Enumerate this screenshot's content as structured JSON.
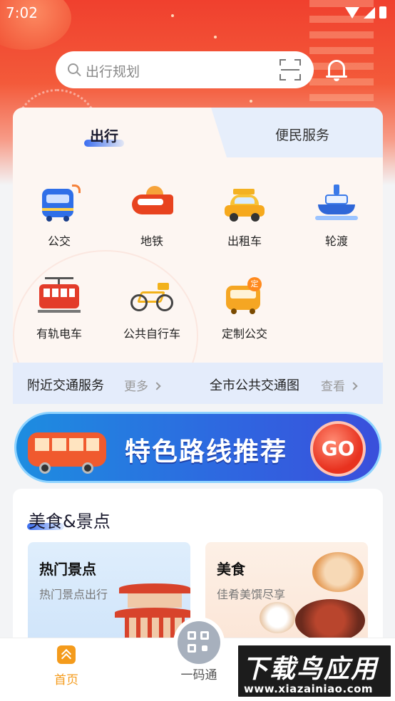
{
  "status_bar": {
    "time": "7:02",
    "icons": [
      "wifi-icon",
      "signal-icon",
      "battery-icon"
    ]
  },
  "search": {
    "placeholder": "出行规划",
    "icons": [
      "search-icon",
      "scan-icon"
    ]
  },
  "header_icons": [
    "bell-icon"
  ],
  "tabs": [
    {
      "label": "出行",
      "active": true
    },
    {
      "label": "便民服务",
      "active": false
    }
  ],
  "services": [
    {
      "label": "公交",
      "icon": "bus-icon"
    },
    {
      "label": "地铁",
      "icon": "subway-icon"
    },
    {
      "label": "出租车",
      "icon": "taxi-icon"
    },
    {
      "label": "轮渡",
      "icon": "ferry-icon"
    },
    {
      "label": "有轨电车",
      "icon": "tram-icon"
    },
    {
      "label": "公共自行车",
      "icon": "bicycle-icon"
    },
    {
      "label": "定制公交",
      "icon": "custom-bus-icon",
      "badge": "定"
    }
  ],
  "info_bar": {
    "left_label": "附近交通服务",
    "left_action": "更多",
    "right_label": "全市公共交通图",
    "right_action": "查看"
  },
  "banner": {
    "title": "特色路线推荐",
    "button": "GO"
  },
  "food_section": {
    "title": "美食&景点",
    "cards": [
      {
        "title": "热门景点",
        "subtitle": "热门景点出行"
      },
      {
        "title": "美食",
        "subtitle": "佳肴美馔尽享"
      }
    ]
  },
  "bottom_nav": [
    {
      "label": "首页",
      "active": true,
      "icon": "home-icon"
    },
    {
      "label": "一码通",
      "active": false,
      "icon": "qr-code-icon"
    }
  ],
  "watermark": {
    "logo": "下载鸟应用",
    "url": "www.xiazainiao.com"
  },
  "colors": {
    "accent": "#f49b1c",
    "hero_red": "#f0402e",
    "tab_blue": "#3a6df0"
  }
}
